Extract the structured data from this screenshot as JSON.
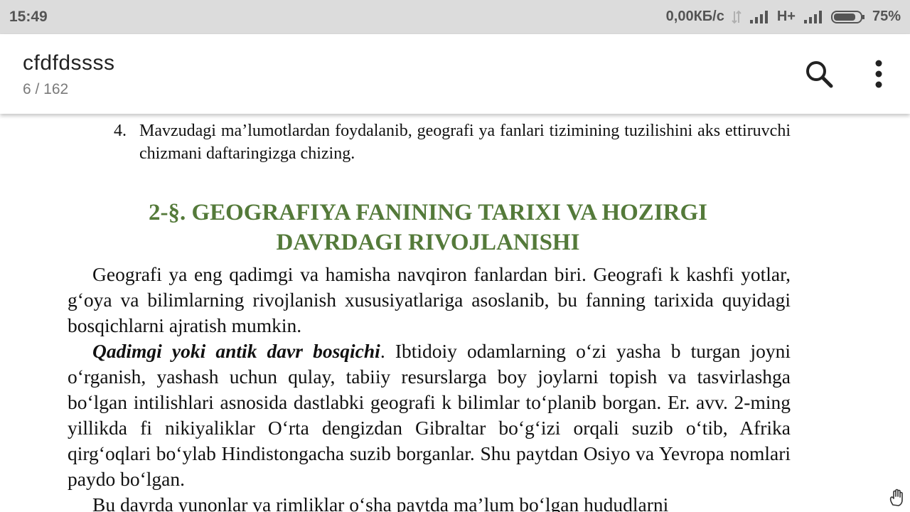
{
  "status_bar": {
    "time": "15:49",
    "net_speed": "0,00КБ/с",
    "network_type": "H+",
    "battery": "75%"
  },
  "toolbar": {
    "title": "cfdfdssss",
    "page_counter": "6 / 162",
    "search_icon": "search-icon",
    "more_icon": "more-vert-icon"
  },
  "document": {
    "list_item": {
      "number": "4.",
      "text": "Mavzudagi ma’lumotlardan foydalanib, geografi ya fanlari tizimining tuzilishini aks ettiruvchi chizmani daftaringizga chizing."
    },
    "heading": {
      "line1": "2-§. GEOGRAFIYA FANINING TARIXI VA HOZIRGI",
      "line2": "DAVRDAGI RIVOJLANISHI"
    },
    "paragraphs": [
      {
        "emphasis": "",
        "text": "Geografi ya eng qadimgi va hamisha navqiron fanlardan biri. Geografi k kashfi yotlar, g‘oya va bilimlarning rivojlanish xususiyatlariga asoslanib, bu fanning tarixida quyidagi bosqichlarni ajratish mumkin."
      },
      {
        "emphasis": "Qadimgi yoki antik davr bosqichi",
        "text": ". Ibtidoiy odamlarning o‘zi yasha b turgan joyni o‘rganish, yashash uchun qulay, tabiiy resurslarga boy joylarni topish va tasvirlashga bo‘lgan intilishlari asnosida dastlabki geografi k bilimlar to‘planib borgan. Er. avv. 2-ming yillikda fi nikiyaliklar O‘rta dengizdan Gibraltar bo‘g‘izi orqali suzib o‘tib, Afrika qirg‘oqlari bo‘ylab Hindistongacha suzib borganlar. Shu paytdan Osiyo va Yevropa nomlari paydo bo‘lgan."
      },
      {
        "emphasis": "",
        "text": "Bu davrda yunonlar va rimliklar o‘sha paytda ma’lum bo‘lgan hududlarni"
      }
    ]
  },
  "colors": {
    "heading": "#547a3a",
    "status_bar_bg": "#dcdcdc"
  }
}
